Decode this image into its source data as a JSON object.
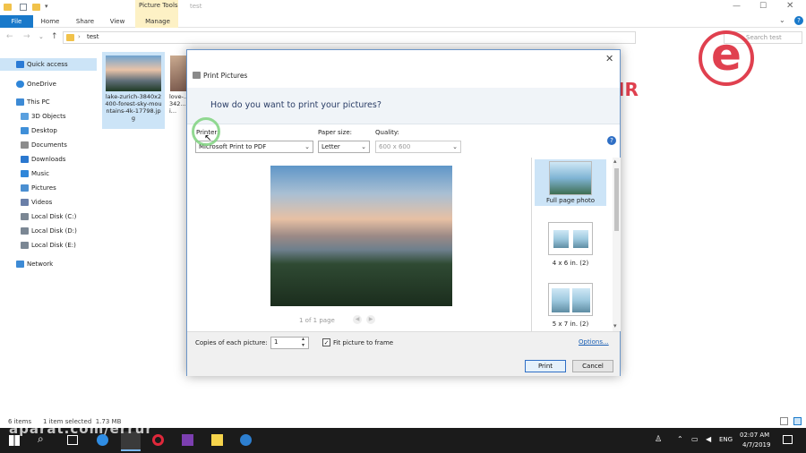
{
  "window": {
    "title": "test",
    "context_tab_group": "Picture Tools"
  },
  "ribbon": {
    "tabs": [
      "File",
      "Home",
      "Share",
      "View",
      "Manage"
    ]
  },
  "address": {
    "path": "test",
    "search_placeholder": "Search test"
  },
  "sidebar": {
    "items": [
      {
        "label": "Quick access",
        "icon": "star-icon",
        "color": "#2a7ad5"
      },
      {
        "label": "OneDrive",
        "icon": "cloud-icon",
        "color": "#2f86d9"
      },
      {
        "label": "This PC",
        "icon": "pc-icon",
        "color": "#3d8ad5"
      },
      {
        "label": "3D Objects",
        "icon": "cube-icon",
        "color": "#5aa0df"
      },
      {
        "label": "Desktop",
        "icon": "desktop-icon",
        "color": "#3f8fd8"
      },
      {
        "label": "Documents",
        "icon": "document-icon",
        "color": "#8c8c8c"
      },
      {
        "label": "Downloads",
        "icon": "download-icon",
        "color": "#2b78cf"
      },
      {
        "label": "Music",
        "icon": "music-icon",
        "color": "#2f86d9"
      },
      {
        "label": "Pictures",
        "icon": "pictures-icon",
        "color": "#4b8fd1"
      },
      {
        "label": "Videos",
        "icon": "videos-icon",
        "color": "#6a7fa8"
      },
      {
        "label": "Local Disk (C:)",
        "icon": "disk-icon",
        "color": "#7b8794"
      },
      {
        "label": "Local Disk (D:)",
        "icon": "disk-icon",
        "color": "#7b8794"
      },
      {
        "label": "Local Disk (E:)",
        "icon": "disk-icon",
        "color": "#7b8794"
      },
      {
        "label": "Network",
        "icon": "network-icon",
        "color": "#3d8ad5"
      }
    ]
  },
  "files": [
    {
      "name": "lake-zurich-3840x2400-forest-sky-mountains-4k-17798.jpg"
    },
    {
      "name": "love-...x342...pari..."
    }
  ],
  "status": {
    "items": "6 items",
    "selected": "1 item selected  1.73 MB"
  },
  "dialog": {
    "title": "Print Pictures",
    "question": "How do you want to print your pictures?",
    "printer_label": "Printer:",
    "printer_value": "Microsoft Print to PDF",
    "paper_label": "Paper size:",
    "paper_value": "Letter",
    "quality_label": "Quality:",
    "quality_value": "600 x 600",
    "page_indicator": "1 of 1 page",
    "layouts": [
      {
        "label": "Full page photo"
      },
      {
        "label": "4 x 6 in. (2)"
      },
      {
        "label": "5 x 7 in. (2)"
      }
    ],
    "copies_label": "Copies of each picture:",
    "copies_value": "1",
    "fit_label": "Fit picture to frame",
    "fit_checked": true,
    "options_link": "Options...",
    "print_button": "Print",
    "cancel_button": "Cancel"
  },
  "taskbar": {
    "time": "02:07 AM",
    "date": "4/7/2019",
    "lang": "ENG"
  },
  "watermark": {
    "text": "aparat.com/errur",
    "logo_text": "IR"
  }
}
